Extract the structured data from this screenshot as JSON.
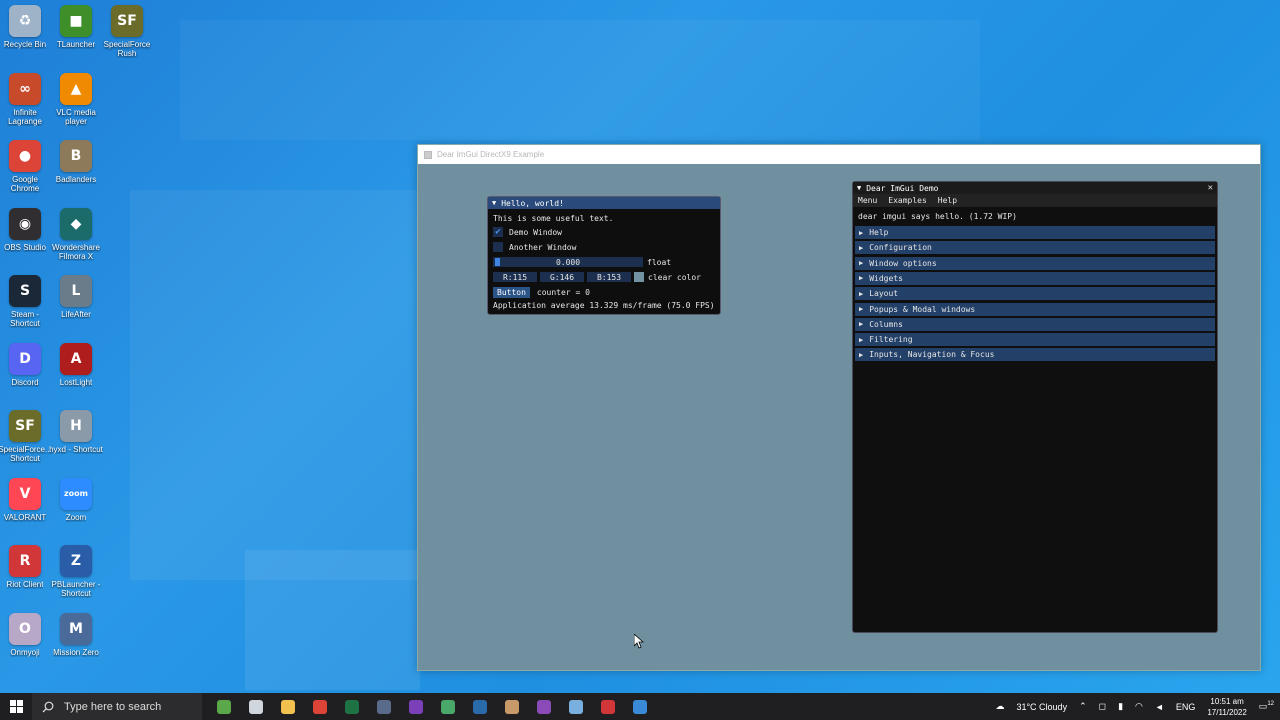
{
  "desktop": {
    "icons": [
      {
        "label": "Recycle Bin",
        "color": "#9fb3c8",
        "glyph": "♻"
      },
      {
        "label": "TLauncher",
        "color": "#3e8e2a",
        "glyph": "■"
      },
      {
        "label": "SpecialForce Rush",
        "color": "#6b6b2a",
        "glyph": "SF"
      },
      {
        "label": "Infinite Lagrange",
        "color": "#c74b2b",
        "glyph": "∞"
      },
      {
        "label": "VLC media player",
        "color": "#f08a00",
        "glyph": "▲"
      },
      {
        "label": "Google Chrome",
        "color": "#db4437",
        "glyph": "●"
      },
      {
        "label": "Badlanders",
        "color": "#8c7a5a",
        "glyph": "B"
      },
      {
        "label": "OBS Studio",
        "color": "#302e31",
        "glyph": "◉"
      },
      {
        "label": "Wondershare Filmora X",
        "color": "#1b6b6b",
        "glyph": "◆"
      },
      {
        "label": "Steam - Shortcut",
        "color": "#1b2838",
        "glyph": "S"
      },
      {
        "label": "LifeAfter",
        "color": "#6a7b8a",
        "glyph": "L"
      },
      {
        "label": "Discord",
        "color": "#5865f2",
        "glyph": "D"
      },
      {
        "label": "LostLight",
        "color": "#b01d1d",
        "glyph": "A"
      },
      {
        "label": "SpecialForce... Shortcut",
        "color": "#6b6b2a",
        "glyph": "SF"
      },
      {
        "label": "hyxd - Shortcut",
        "color": "#8a9aa8",
        "glyph": "H"
      },
      {
        "label": "VALORANT",
        "color": "#ff4655",
        "glyph": "V"
      },
      {
        "label": "Zoom",
        "color": "#2d8cff",
        "glyph": "zoom"
      },
      {
        "label": "Riot Client",
        "color": "#d13639",
        "glyph": "R"
      },
      {
        "label": "PBLauncher - Shortcut",
        "color": "#2a5da8",
        "glyph": "Z"
      },
      {
        "label": "Onmyoji",
        "color": "#b8a8c8",
        "glyph": "O"
      },
      {
        "label": "Mission Zero",
        "color": "#4a6a9a",
        "glyph": "M"
      }
    ]
  },
  "host_window": {
    "title": "Dear ImGui DirectX9 Example",
    "background_color": "#71909f"
  },
  "hello_window": {
    "title": "Hello, world!",
    "text": "This is some useful text.",
    "demo_window_label": "Demo Window",
    "demo_window_checked": true,
    "another_window_label": "Another Window",
    "another_window_checked": false,
    "slider_value": "0.000",
    "slider_label": "float",
    "color_r": "R:115",
    "color_g": "G:146",
    "color_b": "B:153",
    "color_label": "clear color",
    "button_label": "Button",
    "counter_text": "counter = 0",
    "fps_text": "Application average 13.329 ms/frame (75.0 FPS)"
  },
  "demo_window": {
    "title": "Dear ImGui Demo",
    "menu": [
      "Menu",
      "Examples",
      "Help"
    ],
    "hello_text": "dear imgui says hello. (1.72 WIP)",
    "headers": [
      "Help",
      "Configuration",
      "Window options",
      "Widgets",
      "Layout",
      "Popups & Modal windows",
      "Columns",
      "Filtering",
      "Inputs, Navigation & Focus"
    ]
  },
  "taskbar": {
    "search_placeholder": "Type here to search",
    "weather": "31°C  Cloudy",
    "language": "ENG",
    "time": "10:51 am",
    "date": "17/11/2022",
    "notification_count": "12",
    "pinned": [
      {
        "name": "paint-icon",
        "color": "#5aa84a"
      },
      {
        "name": "task-view-icon",
        "color": "#cfd6dd"
      },
      {
        "name": "file-explorer-icon",
        "color": "#f2c14e"
      },
      {
        "name": "chrome-icon",
        "color": "#db4437"
      },
      {
        "name": "excel-icon",
        "color": "#1f7244"
      },
      {
        "name": "calculator-icon",
        "color": "#5a6a8a"
      },
      {
        "name": "visual-studio-icon",
        "color": "#7b3fb8"
      },
      {
        "name": "app-icon-green",
        "color": "#4aa86a"
      },
      {
        "name": "app-icon-blue",
        "color": "#2a6aa8"
      },
      {
        "name": "character-app-icon",
        "color": "#c89a6a"
      },
      {
        "name": "visual-studio-2-icon",
        "color": "#8a4ab8"
      },
      {
        "name": "app-icon-light",
        "color": "#7ab0e0"
      },
      {
        "name": "app-icon-red",
        "color": "#d13639"
      },
      {
        "name": "imgui-app-icon",
        "color": "#3a8ad8"
      }
    ]
  }
}
